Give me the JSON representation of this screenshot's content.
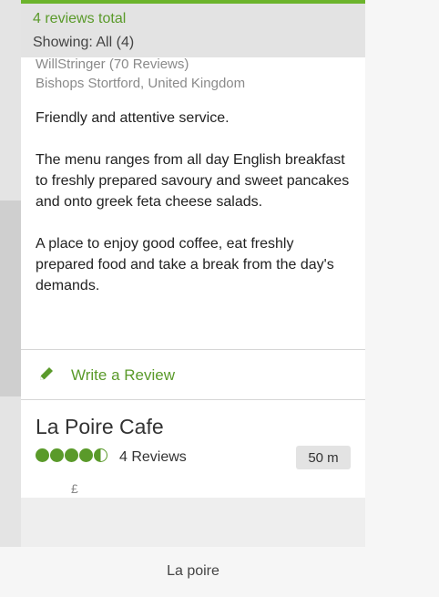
{
  "header": {
    "total": "4 reviews total",
    "showing": "Showing: All (4)"
  },
  "review": {
    "author": "WillStringer  (70 Reviews)",
    "location": "Bishops Stortford, United Kingdom",
    "paragraphs": [
      "Friendly and attentive service.",
      "The menu ranges from  all day English breakfast to freshly prepared savoury and sweet pancakes and onto  greek  feta cheese salads.",
      "A place to enjoy good coffee, eat freshly prepared  food and take a break from the day's demands."
    ]
  },
  "actions": {
    "write_review": "Write a Review"
  },
  "listing": {
    "name": "La Poire Cafe",
    "rating": 4.5,
    "reviews": "4 Reviews",
    "distance": "50 m",
    "price": "£"
  },
  "caption": "La poire",
  "colors": {
    "accent": "#5a9a2a",
    "header_bg": "#e3e3e3"
  }
}
